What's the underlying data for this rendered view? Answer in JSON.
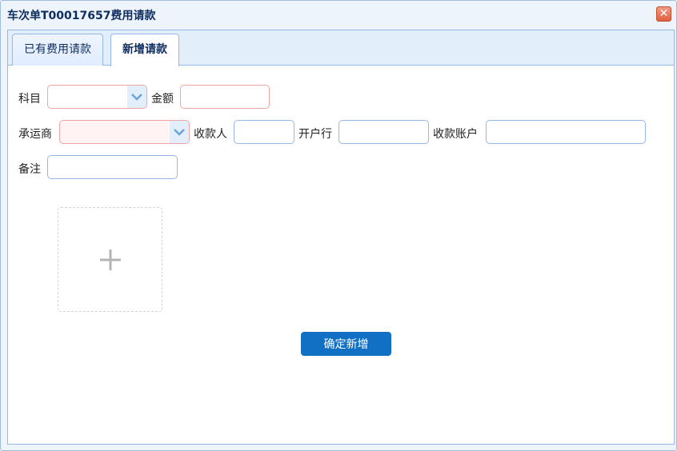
{
  "window": {
    "title": "车次单T00017657费用请款",
    "close_glyph": "✕"
  },
  "tabs": [
    {
      "label": "已有费用请款",
      "active": false
    },
    {
      "label": "新增请款",
      "active": true
    }
  ],
  "form": {
    "subject_label": "科目",
    "amount_label": "金额",
    "carrier_label": "承运商",
    "payee_label": "收款人",
    "bank_label": "开户行",
    "account_label": "收款账户",
    "remark_label": "备注",
    "subject_value": "",
    "amount_value": "",
    "carrier_value": "",
    "payee_value": "",
    "bank_value": "",
    "account_value": "",
    "remark_value": ""
  },
  "upload": {
    "icon": "plus-icon"
  },
  "submit_label": "确定新增",
  "colors": {
    "accent": "#1170c3",
    "border": "#95b8e7",
    "invalid_border": "#f0a5a5",
    "title": "#0e2d5f"
  }
}
